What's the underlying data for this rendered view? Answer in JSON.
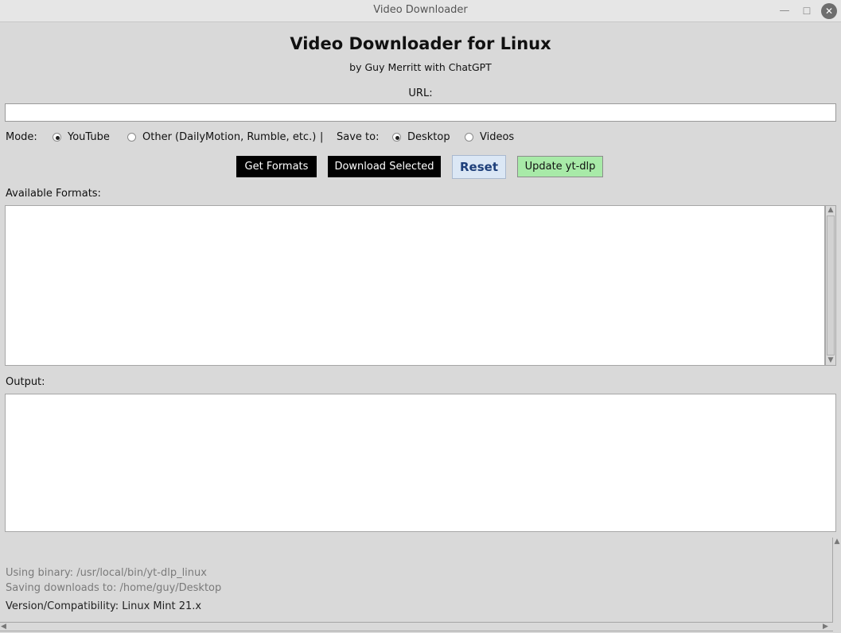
{
  "window": {
    "title": "Video Downloader",
    "min_glyph": "—",
    "max_glyph": "☐",
    "close_glyph": "✕"
  },
  "header": {
    "title": "Video Downloader for Linux",
    "subtitle": "by Guy Merritt with ChatGPT"
  },
  "url": {
    "label": "URL:",
    "value": ""
  },
  "mode": {
    "label": "Mode:",
    "options": [
      {
        "label": "YouTube",
        "selected": true
      },
      {
        "label": "Other (DailyMotion, Rumble, etc.)",
        "selected": false
      }
    ],
    "separator": "|"
  },
  "save_to": {
    "label": "Save to:",
    "options": [
      {
        "label": "Desktop",
        "selected": true
      },
      {
        "label": "Videos",
        "selected": false
      }
    ]
  },
  "buttons": {
    "get_formats": "Get Formats",
    "download_selected": "Download Selected",
    "reset": "Reset",
    "update": "Update yt-dlp"
  },
  "formats": {
    "label": "Available Formats:"
  },
  "output": {
    "label": "Output:"
  },
  "status": {
    "binary": "Using binary: /usr/local/bin/yt-dlp_linux",
    "saving": "Saving downloads to: /home/guy/Desktop",
    "version": "Version/Compatibility: Linux Mint 21.x"
  },
  "colors": {
    "background": "#d9d9d9",
    "dark_button": "#000000",
    "reset_button": "#dbe7f5",
    "reset_text": "#1e3f7a",
    "update_button": "#a8eaa8"
  }
}
